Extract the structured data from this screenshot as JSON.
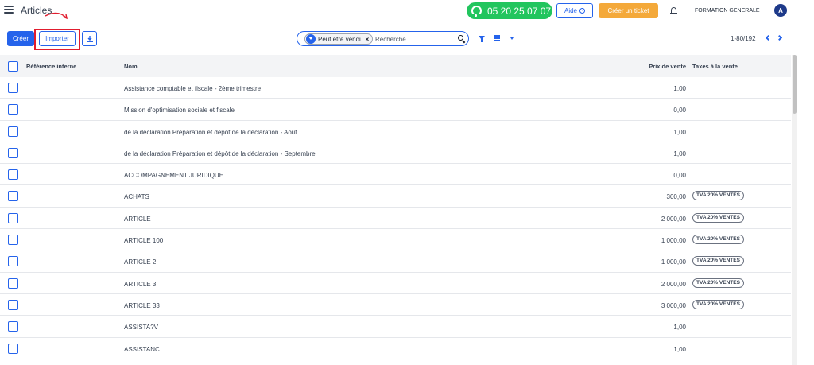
{
  "header": {
    "title": "Articles",
    "phone": "05 20 25 07 07",
    "aide_label": "Aide",
    "ticket_label": "Créer un ticket",
    "company": "FORMATION GENERALE",
    "avatar_letter": "A"
  },
  "toolbar": {
    "create_label": "Créer",
    "import_label": "Importer",
    "facet_label": "Peut être vendu",
    "search_placeholder": "Recherche...",
    "pager": "1-80/192"
  },
  "table": {
    "columns": [
      "Référence interne",
      "Nom",
      "Prix de vente",
      "Taxes à la vente"
    ],
    "rows": [
      {
        "ref": "",
        "name": "Assistance comptable et fiscale - 2ème trimestre",
        "price": "1,00",
        "tax": ""
      },
      {
        "ref": "",
        "name": "Mission d'optimisation sociale et fiscale",
        "price": "0,00",
        "tax": ""
      },
      {
        "ref": "",
        "name": "de la déclaration Préparation et dépôt de la déclaration - Aout",
        "price": "1,00",
        "tax": ""
      },
      {
        "ref": "",
        "name": "de la déclaration Préparation et dépôt de la déclaration - Septembre",
        "price": "1,00",
        "tax": ""
      },
      {
        "ref": "",
        "name": "ACCOMPAGNEMENT JURIDIQUE",
        "price": "0,00",
        "tax": ""
      },
      {
        "ref": "",
        "name": "ACHATS",
        "price": "300,00",
        "tax": "TVA 20% VENTES"
      },
      {
        "ref": "",
        "name": "ARTICLE",
        "price": "2 000,00",
        "tax": "TVA 20% VENTES"
      },
      {
        "ref": "",
        "name": "ARTICLE 100",
        "price": "1 000,00",
        "tax": "TVA 20% VENTES"
      },
      {
        "ref": "",
        "name": "ARTICLE 2",
        "price": "1 000,00",
        "tax": "TVA 20% VENTES"
      },
      {
        "ref": "",
        "name": "ARTICLE 3",
        "price": "2 000,00",
        "tax": "TVA 20% VENTES"
      },
      {
        "ref": "",
        "name": "ARTICLE 33",
        "price": "3 000,00",
        "tax": "TVA 20% VENTES"
      },
      {
        "ref": "",
        "name": "ASSISTA?V",
        "price": "1,00",
        "tax": ""
      },
      {
        "ref": "",
        "name": "ASSISTANC",
        "price": "1,00",
        "tax": ""
      }
    ]
  },
  "colors": {
    "primary": "#2563eb",
    "phone_green": "#22c55e",
    "ticket_orange": "#f4a93a",
    "highlight_red": "#e11d2e"
  }
}
